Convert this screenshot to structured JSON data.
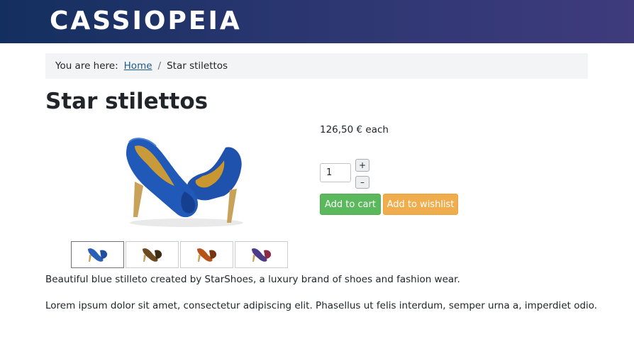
{
  "header": {
    "brand": "CASSIOPEIA"
  },
  "breadcrumb": {
    "prefix": "You are here:",
    "home": "Home",
    "separator": "/",
    "current": "Star stilettos"
  },
  "product": {
    "title": "Star stilettos",
    "price": "126,50 € each",
    "quantity": "1",
    "plus_label": "+",
    "minus_label": "–",
    "add_to_cart": "Add to cart",
    "add_to_wishlist": "Add to wishlist",
    "thumbnails": [
      {
        "color": "#2a5fb8",
        "selected": true
      },
      {
        "color": "#6b4a1f",
        "selected": false
      },
      {
        "color": "#b8521a",
        "selected": false
      },
      {
        "color": "#4a3a8a",
        "selected": false
      }
    ],
    "main_image_color": "#2059b8",
    "description": [
      "Beautiful blue stilleto created by StarShoes, a luxury brand of shoes and fashion wear.",
      "Lorem ipsum dolor sit amet, consectetur adipiscing elit. Phasellus ut felis interdum, semper urna a, imperdiet odio."
    ]
  },
  "colors": {
    "cart_green": "#5cb85c",
    "wishlist_orange": "#f0ad4e",
    "link_blue": "#1e5a8a"
  }
}
